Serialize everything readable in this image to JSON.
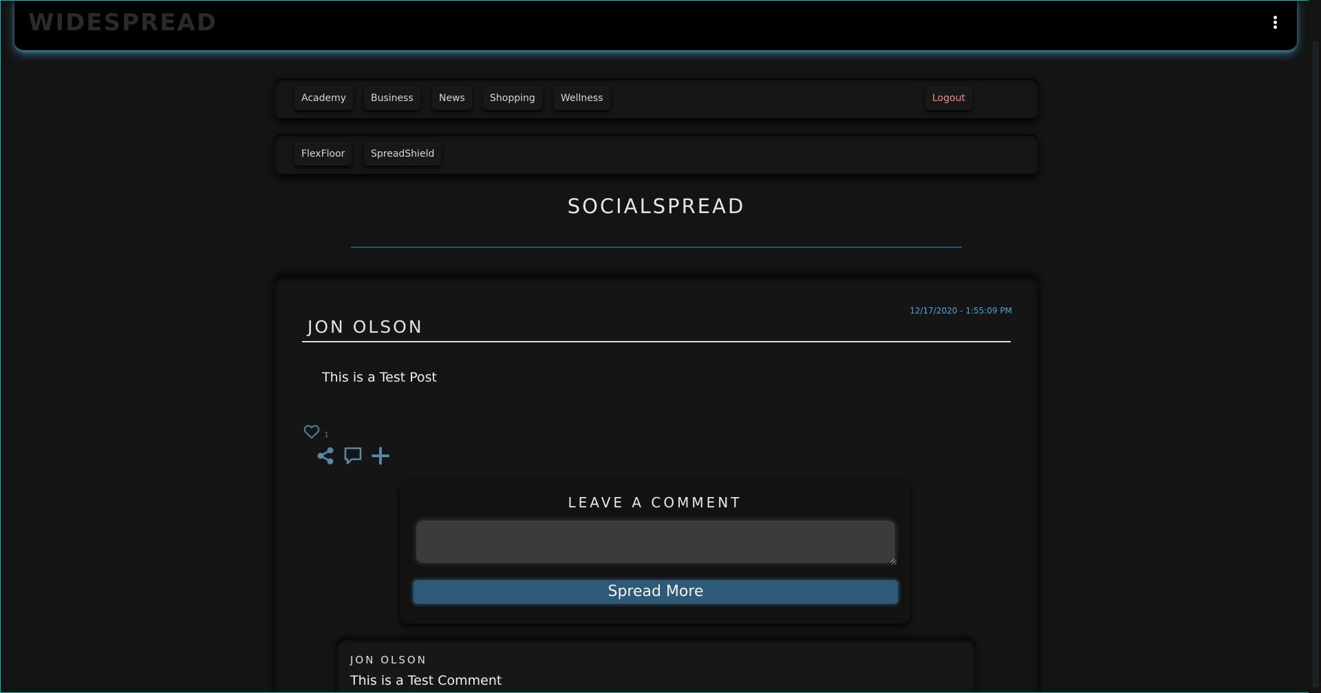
{
  "app": {
    "brand": "WIDESPREAD"
  },
  "nav_primary": {
    "items": [
      "Academy",
      "Business",
      "News",
      "Shopping",
      "Wellness"
    ],
    "logout": "Logout"
  },
  "nav_secondary": {
    "items": [
      "FlexFloor",
      "SpreadShield"
    ]
  },
  "page": {
    "title": "SOCIALSPREAD"
  },
  "post": {
    "author": "JON OLSON",
    "timestamp": "12/17/2020 - 1:55:09 PM",
    "body": "This is a Test Post",
    "like_count": "1",
    "icons": [
      "heart-icon",
      "share-icon",
      "comment-icon",
      "plus-icon"
    ]
  },
  "comment_form": {
    "heading": "LEAVE A COMMENT",
    "input_value": "",
    "submit_label": "Spread More"
  },
  "comments": [
    {
      "author": "JON OLSON",
      "body": "This is a Test Comment"
    }
  ],
  "colors": {
    "accent": "#4aa7d8",
    "button": "#2e5a78",
    "logout": "#f08c8c",
    "background": "#141414",
    "frame_border": "#1fb3b3"
  }
}
